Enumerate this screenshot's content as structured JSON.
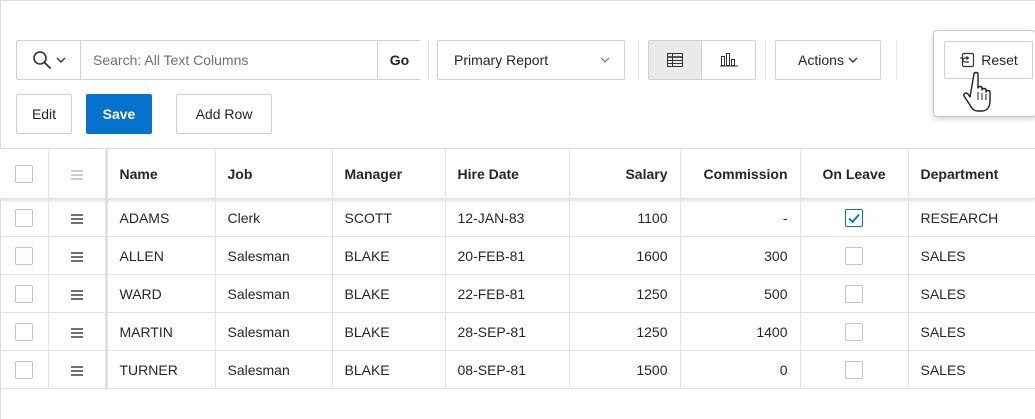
{
  "toolbar": {
    "search_placeholder": "Search: All Text Columns",
    "go_label": "Go",
    "report_selected": "Primary Report",
    "actions_label": "Actions",
    "reset_label": "Reset",
    "edit_label": "Edit",
    "save_label": "Save",
    "add_row_label": "Add Row"
  },
  "icons": {
    "search": "search-icon",
    "chevron": "chevron-down-icon",
    "grid_view": "grid-view-icon",
    "chart_view": "chart-view-icon",
    "reset": "reset-icon",
    "row_actions": "row-actions-menu-icon",
    "cursor": "hand-pointer-icon"
  },
  "colors": {
    "accent": "#0572ce",
    "border": "#d0d0d0"
  },
  "grid": {
    "columns": [
      "Name",
      "Job",
      "Manager",
      "Hire Date",
      "Salary",
      "Commission",
      "On Leave",
      "Department"
    ],
    "rows": [
      {
        "name": "ADAMS",
        "job": "Clerk",
        "manager": "SCOTT",
        "hire_date": "12-JAN-83",
        "salary": "1100",
        "commission": "-",
        "on_leave": true,
        "department": "RESEARCH"
      },
      {
        "name": "ALLEN",
        "job": "Salesman",
        "manager": "BLAKE",
        "hire_date": "20-FEB-81",
        "salary": "1600",
        "commission": "300",
        "on_leave": false,
        "department": "SALES"
      },
      {
        "name": "WARD",
        "job": "Salesman",
        "manager": "BLAKE",
        "hire_date": "22-FEB-81",
        "salary": "1250",
        "commission": "500",
        "on_leave": false,
        "department": "SALES"
      },
      {
        "name": "MARTIN",
        "job": "Salesman",
        "manager": "BLAKE",
        "hire_date": "28-SEP-81",
        "salary": "1250",
        "commission": "1400",
        "on_leave": false,
        "department": "SALES"
      },
      {
        "name": "TURNER",
        "job": "Salesman",
        "manager": "BLAKE",
        "hire_date": "08-SEP-81",
        "salary": "1500",
        "commission": "0",
        "on_leave": false,
        "department": "SALES"
      }
    ]
  }
}
